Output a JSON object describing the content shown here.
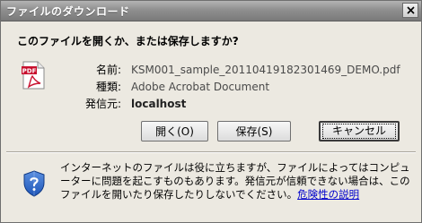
{
  "title": "ファイルのダウンロード",
  "question": "このファイルを開くか、または保存しますか?",
  "file": {
    "name_label": "名前:",
    "name_value": "KSM001_sample_20110419182301469_DEMO.pdf",
    "type_label": "種類:",
    "type_value": "Adobe Acrobat Document",
    "from_label": "発信元:",
    "from_value": "localhost"
  },
  "buttons": {
    "open": "開く(O)",
    "save": "保存(S)",
    "cancel": "キャンセル"
  },
  "warning": {
    "text": "インターネットのファイルは役に立ちますが、ファイルによってはコンピューターに問題を起こすものもあります。発信元が信頼できない場合は、このファイルを開いたり保存したりしないでください。",
    "link": "危険性の説明"
  },
  "icons": {
    "pdf_label": "PDF",
    "close": "close-icon",
    "pdf": "pdf-file-icon",
    "shield": "security-shield-icon"
  },
  "colors": {
    "link": "#0000cc",
    "pdf_red": "#c8102e",
    "shield_blue": "#1e56b8"
  }
}
